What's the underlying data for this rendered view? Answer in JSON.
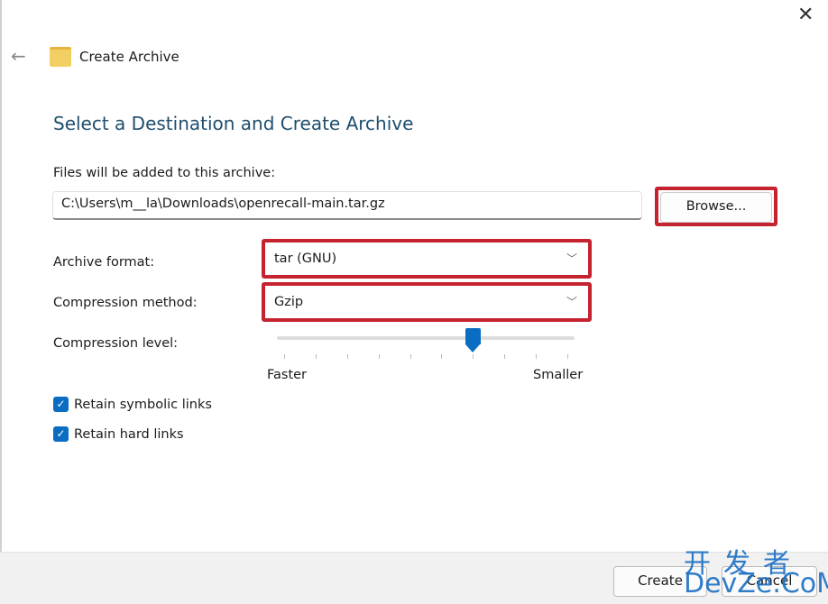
{
  "window": {
    "title": "Create Archive",
    "close_icon": "close-icon",
    "back_icon": "back-arrow-icon"
  },
  "page": {
    "heading": "Select a Destination and Create Archive"
  },
  "destination": {
    "label": "Files will be added to this archive:",
    "value": "C:\\Users\\m__la\\Downloads\\openrecall-main.tar.gz",
    "browse_label": "Browse..."
  },
  "format": {
    "label": "Archive format:",
    "value": "tar (GNU)"
  },
  "compression": {
    "label": "Compression method:",
    "value": "Gzip"
  },
  "level": {
    "label": "Compression level:",
    "min_label": "Faster",
    "max_label": "Smaller",
    "value": 6,
    "min": 0,
    "max": 9
  },
  "options": [
    {
      "label": "Retain symbolic links",
      "checked": true
    },
    {
      "label": "Retain hard links",
      "checked": true
    }
  ],
  "footer": {
    "create_label": "Create",
    "cancel_label": "Cancel"
  },
  "watermark": {
    "line1": "开发者",
    "line2": "DevZe.CoM"
  },
  "colors": {
    "accent": "#0a6dc2",
    "highlight": "#c4232f",
    "heading": "#1f4e6e"
  }
}
